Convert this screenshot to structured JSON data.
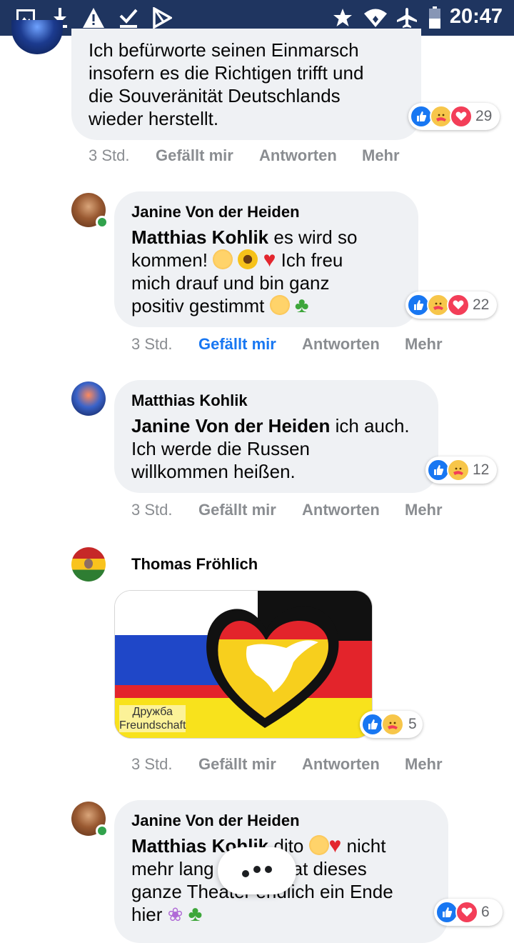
{
  "statusbar": {
    "time": "20:47",
    "left_icons": [
      "image-icon",
      "download-icon",
      "warning-icon",
      "check-icon",
      "play-store-icon"
    ],
    "right_icons": [
      "star-icon",
      "wifi-icon",
      "airplane-icon",
      "battery-icon"
    ]
  },
  "comments": [
    {
      "text": "Ich befürworte seinen Einmarsch insofern es die Richtigen trifft und die Souveränität Deutschlands wieder herstellt.",
      "lines": [
        "Ich befürworte seinen Einmarsch",
        "insofern es die Richtigen trifft und",
        "die Souveränität Deutschlands",
        "wieder herstellt."
      ],
      "reactions": [
        "like",
        "care",
        "love"
      ],
      "reaction_count": "29",
      "time": "3 Std.",
      "like_label": "Gefällt mir",
      "liked": false,
      "reply_label": "Antworten",
      "more_label": "Mehr"
    },
    {
      "author": "Janine Von der Heiden",
      "mention": "Matthias Kohlik",
      "lines": [
        " es wird so",
        "kommen! ",
        " Ich freu",
        "mich drauf und bin ganz",
        "positiv gestimmt "
      ],
      "reactions": [
        "like",
        "care",
        "love"
      ],
      "reaction_count": "22",
      "time": "3 Std.",
      "like_label": "Gefällt mir",
      "liked": true,
      "reply_label": "Antworten",
      "more_label": "Mehr",
      "online": true
    },
    {
      "author": "Matthias Kohlik",
      "mention": "Janine Von der Heiden",
      "lines": [
        " ich auch.",
        "Ich werde die Russen",
        "willkommen heißen."
      ],
      "reactions": [
        "like",
        "care"
      ],
      "reaction_count": "12",
      "time": "3 Std.",
      "like_label": "Gefällt mir",
      "liked": false,
      "reply_label": "Antworten",
      "more_label": "Mehr"
    },
    {
      "author": "Thomas Fröhlich",
      "image": {
        "caption_line1": "Дружба",
        "caption_line2": "Freundschaft"
      },
      "reactions": [
        "like",
        "care"
      ],
      "reaction_count": "5",
      "time": "3 Std.",
      "like_label": "Gefällt mir",
      "liked": false,
      "reply_label": "Antworten",
      "more_label": "Mehr"
    },
    {
      "author": "Janine Von der Heiden",
      "mention": "Matthias Kohlik",
      "lines": [
        " dito ",
        " nicht",
        "mehr lang",
        "at dieses",
        "ganze Theater endlich ein Ende",
        "hier "
      ],
      "reactions": [
        "like",
        "love"
      ],
      "reaction_count": "6",
      "online": true
    }
  ],
  "colors": {
    "statusbar": "#1f3560",
    "bubble": "#eff1f4",
    "link_blue": "#1877f2",
    "meta_gray": "#8a8d91"
  }
}
